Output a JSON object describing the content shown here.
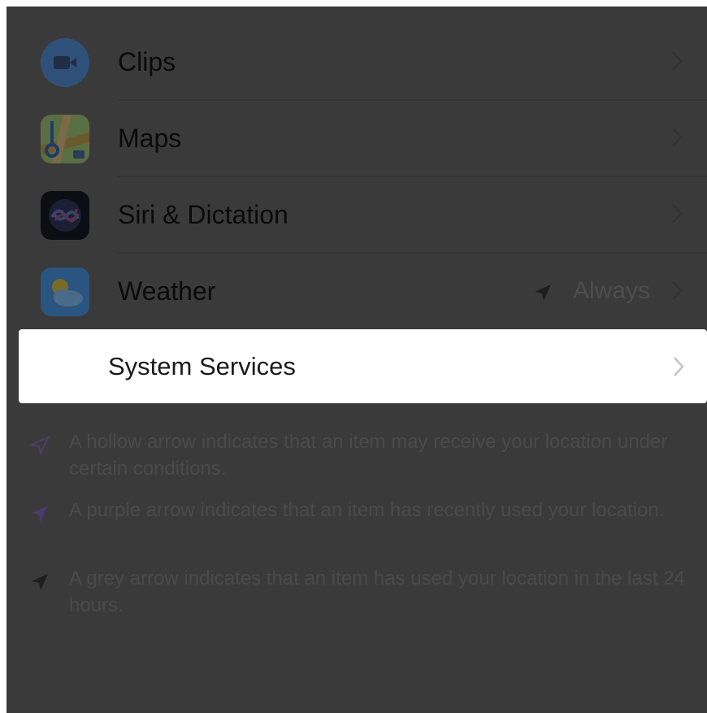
{
  "items": [
    {
      "label": "Clips",
      "icon": "clips-icon",
      "color": "#3a5d8f"
    },
    {
      "label": "Maps",
      "icon": "maps-icon",
      "color": "#4f6a3c"
    },
    {
      "label": "Siri & Dictation",
      "icon": "siri-icon",
      "color": "#0f0f18"
    },
    {
      "label": "Weather",
      "icon": "weather-icon",
      "color": "#2d5a86",
      "detail": "Always",
      "detail_icon": "location-arrow-icon"
    }
  ],
  "system_services": {
    "label": "System Services"
  },
  "footer_notes": [
    {
      "icon": "hollow-arrow-icon",
      "color": "#4a3f66",
      "text": "A hollow arrow indicates that an item may receive your location under certain conditions."
    },
    {
      "icon": "purple-arrow-icon",
      "color": "#4a3a6e",
      "text": "A purple arrow indicates that an item has recently used your location."
    },
    {
      "icon": "grey-arrow-icon",
      "color": "#1e1e1e",
      "text": "A grey arrow indicates that an item has used your location in the last 24 hours."
    }
  ],
  "colors": {
    "overlay": "#3a3a3a",
    "highlight": "#ffffff"
  }
}
